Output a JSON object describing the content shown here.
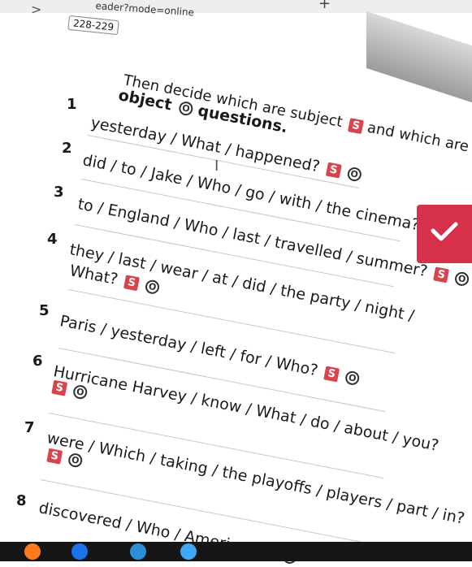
{
  "browser": {
    "url_text": "eader?mode=online",
    "page_indicator": "228-229"
  },
  "exercise": {
    "instruction_line1": "Then decide which are subject",
    "instruction_badge": "S",
    "instruction_line1_tail": "and which are",
    "instruction_line2": "object",
    "instruction_line2_badge": "O",
    "instruction_line2_tail": "questions.",
    "badge_s": "S",
    "badge_o": "O",
    "items": [
      {
        "num": "1",
        "text": "yesterday / What / happened?"
      },
      {
        "num": "2",
        "text": "did / to / Jake / Who / go / with / the cinema?"
      },
      {
        "num": "3",
        "text": "to / England / Who / last / travelled / summer?"
      },
      {
        "num": "4",
        "text": "they / last / wear / at / did / the party / night /",
        "text2": "What?"
      },
      {
        "num": "5",
        "text": "Paris / yesterday / left / for / Who?"
      },
      {
        "num": "6",
        "text": "Hurricane Harvey / know / What / do / about / you?"
      },
      {
        "num": "7",
        "text": "were / Which / taking / the playoffs / players / part / in?"
      },
      {
        "num": "8",
        "text": "discovered / Who / America?"
      }
    ]
  },
  "colors": {
    "accent": "#d6304a",
    "badge_s": "#d8434e"
  }
}
